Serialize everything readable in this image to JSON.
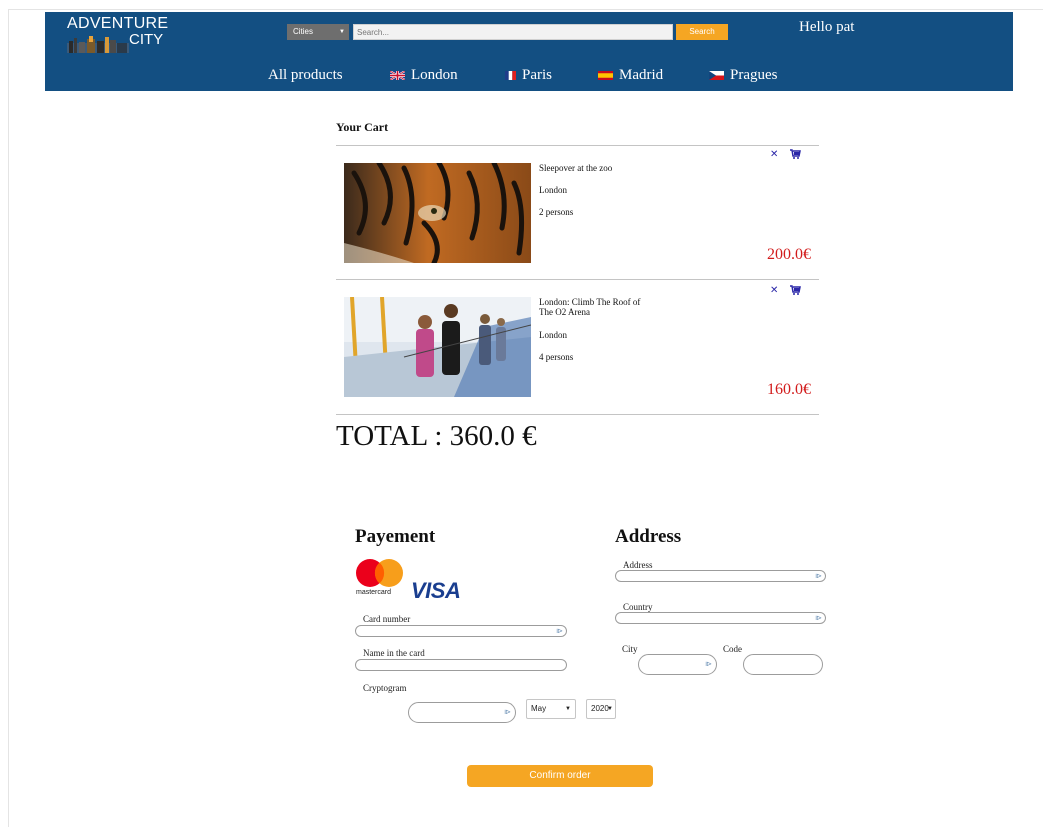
{
  "header": {
    "logo": {
      "line1": "ADVENTURE",
      "line2": "CITY"
    },
    "city_select": {
      "value": "Cities"
    },
    "search": {
      "placeholder": "Search...",
      "button_label": "Search"
    },
    "greeting": "Hello pat",
    "nav": [
      {
        "label": "All products"
      },
      {
        "label": "London",
        "flag": "uk-flag-icon"
      },
      {
        "label": "Paris",
        "flag": "france-flag-icon"
      },
      {
        "label": "Madrid",
        "flag": "spain-flag-icon"
      },
      {
        "label": "Pragues",
        "flag": "czech-flag-icon"
      }
    ]
  },
  "cart": {
    "title": "Your Cart",
    "items": [
      {
        "name": "Sleepover at the zoo",
        "city": "London",
        "persons": "2 persons",
        "price": "200.0€",
        "image": "tiger-photo"
      },
      {
        "name": "London: Climb The Roof of The O2 Arena",
        "city": "London",
        "persons": "4 persons",
        "price": "160.0€",
        "image": "roof-climb-photo"
      }
    ],
    "total": "TOTAL : 360.0 €",
    "icons": {
      "remove": "close-icon",
      "cart": "cart-icon"
    }
  },
  "payment": {
    "title": "Payement",
    "card_brands": {
      "mastercard": "mastercard",
      "visa": "VISA"
    },
    "card_number_label": "Card number",
    "name_label": "Name in the card",
    "cryptogram_label": "Cryptogram",
    "month": "May",
    "year": "2020"
  },
  "address": {
    "title": "Address",
    "address_label": "Address",
    "country_label": "Country",
    "city_label": "City",
    "code_label": "Code"
  },
  "confirm_label": "Confirm order",
  "colors": {
    "header_bg": "#134f82",
    "accent": "#f5a623",
    "price": "#d21b1b",
    "icon": "#2a26a8"
  }
}
